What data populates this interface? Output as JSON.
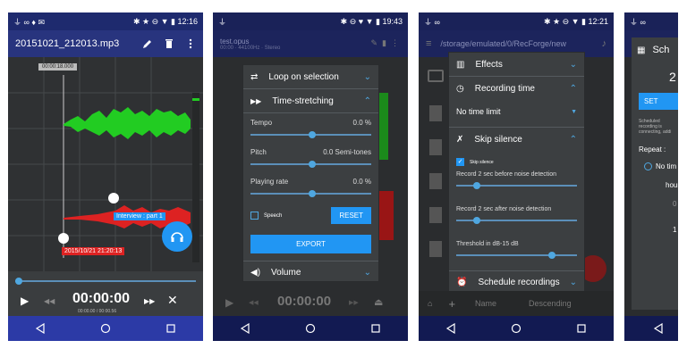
{
  "screen1": {
    "time": "12:16",
    "title": "20151021_212013.mp3",
    "marker_top": "00:00:18.000",
    "marker_bottom": "2015/10/21 21:20:13",
    "interview_label": "Interview : part 1",
    "timer": "00:00:00",
    "timer_sub": "00:00.00 / 00:00.56"
  },
  "screen2": {
    "time": "19:43",
    "file": "test.opus",
    "file_info": "00:00 · 44100Hz · Stereo",
    "loop": "Loop on selection",
    "stretch": "Time-stretching",
    "tempo": "Tempo",
    "tempo_val": "0.0 %",
    "pitch": "Pitch",
    "pitch_val": "0.0 Semi-tones",
    "rate": "Playing rate",
    "rate_val": "0.0 %",
    "speech": "Speech",
    "reset": "RESET",
    "export": "EXPORT",
    "volume": "Volume",
    "timer": "00:00:00"
  },
  "screen3": {
    "time": "12:21",
    "path": "/storage/emulated/0/RecForge/new",
    "effects": "Effects",
    "rec_time": "Recording time",
    "no_limit": "No time limit",
    "skip": "Skip silence",
    "skip_check": "Skip silence",
    "before": "Record 2 sec before noise detection",
    "after": "Record 2 sec after noise detection",
    "threshold": "Threshold in dB-15 dB",
    "schedule": "Schedule recordings",
    "sort_name": "Name",
    "sort_order": "Descending"
  },
  "screen4": {
    "title": "Sch",
    "big": "2",
    "btn": "SET",
    "desc": "Scheduled recording is connecting, addi",
    "repeat": "Repeat :",
    "no": "No tim",
    "hours": "hour",
    "v0": "0",
    "v1": "1"
  },
  "colors": {
    "status_bar": "#1e2a6e",
    "action_bar": "#28347e",
    "nav_bar": "#2c3aa6",
    "accent": "#4fa7e0",
    "wave_green": "#22cc22",
    "wave_red": "#dd2222"
  }
}
